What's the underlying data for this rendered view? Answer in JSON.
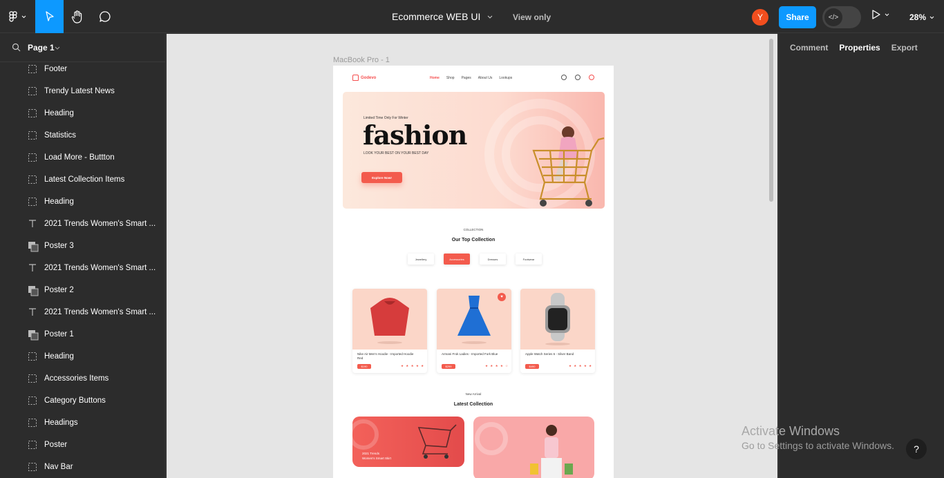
{
  "topbar": {
    "file_title": "Ecommerce WEB UI",
    "view_only": "View only",
    "avatar_initial": "Y",
    "share_label": "Share",
    "zoom": "28%"
  },
  "left_panel": {
    "page_label": "Page 1",
    "layers": [
      {
        "label": "Footer",
        "kind": "frame"
      },
      {
        "label": "Trendy Latest News",
        "kind": "frame"
      },
      {
        "label": "Heading",
        "kind": "frame"
      },
      {
        "label": "Statistics",
        "kind": "frame"
      },
      {
        "label": "Load More - Buttton",
        "kind": "frame"
      },
      {
        "label": "Latest Collection Items",
        "kind": "frame"
      },
      {
        "label": "Heading",
        "kind": "frame"
      },
      {
        "label": "2021 Trends Women's Smart ...",
        "kind": "text"
      },
      {
        "label": "Poster 3",
        "kind": "image"
      },
      {
        "label": "2021 Trends Women's Smart ...",
        "kind": "text"
      },
      {
        "label": "Poster 2",
        "kind": "image"
      },
      {
        "label": "2021 Trends Women's Smart ...",
        "kind": "text"
      },
      {
        "label": "Poster 1",
        "kind": "image"
      },
      {
        "label": "Heading",
        "kind": "frame"
      },
      {
        "label": "Accessories Items",
        "kind": "frame"
      },
      {
        "label": "Category Buttons",
        "kind": "frame"
      },
      {
        "label": "Headings",
        "kind": "frame"
      },
      {
        "label": "Poster",
        "kind": "frame"
      },
      {
        "label": "Nav Bar",
        "kind": "frame"
      }
    ]
  },
  "canvas": {
    "frame_label": "MacBook Pro - 1",
    "site": {
      "brand": "Godevo",
      "nav": [
        "Home",
        "Shop",
        "Pages",
        "About Us",
        "Lookups"
      ],
      "hero_small": "Limited Time Only For Winter",
      "hero_big": "fashion",
      "hero_sub": "LOOK YOUR BEST ON YOUR BEST DAY",
      "hero_button": "Explore Now!",
      "collection_small": "COLLECTION",
      "collection_title": "Our Top Collection",
      "categories": [
        "Jewellery",
        "Accessories",
        "Dresses",
        "Footwear"
      ],
      "products": [
        {
          "name": "Nike Air Men's Hoodie - Imported Hoodie Red",
          "price": "$190",
          "stars": "★ ★ ★ ★ ★"
        },
        {
          "name": "Armani Frok Ladies - Imported Fork Blue",
          "price": "$299",
          "stars": "★ ★ ★ ★ ☆"
        },
        {
          "name": "Apple Watch Series 6 - Silver Band",
          "price": "$490",
          "stars": "★ ★ ★ ★ ★"
        }
      ],
      "arrival_small": "New Arrival",
      "arrival_title": "Latest Collection",
      "poster1_line1": "2021 Trends",
      "poster1_line2": "Women's Smart Skirt"
    }
  },
  "right_panel": {
    "tabs": [
      "Comment",
      "Properties",
      "Export"
    ],
    "active_tab": "Properties"
  },
  "watermark": {
    "line1": "Activate Windows",
    "line2": "Go to Settings to activate Windows."
  },
  "help_label": "?",
  "colors": {
    "accent": "#0d99ff",
    "brand_red": "#f35b4d"
  }
}
